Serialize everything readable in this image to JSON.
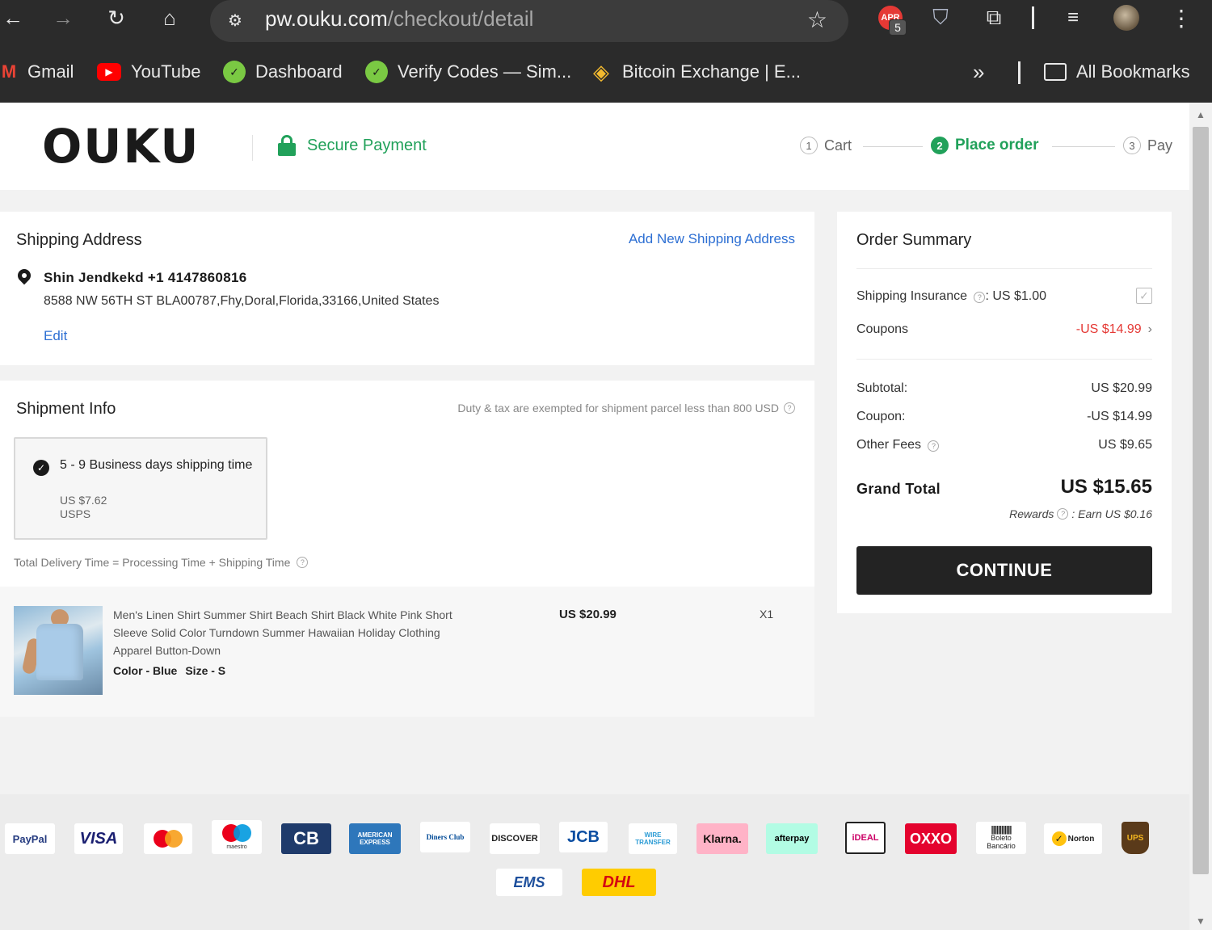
{
  "browser": {
    "url_host": "pw.ouku.com",
    "url_path": "/checkout/detail",
    "extensions": {
      "apr_label": "APR",
      "apr_badge": "5"
    },
    "bookmarks": [
      {
        "label": "Gmail",
        "icon": "gmail-icon"
      },
      {
        "label": "YouTube",
        "icon": "youtube-icon"
      },
      {
        "label": "Dashboard",
        "icon": "dashboard-icon"
      },
      {
        "label": "Verify Codes — Sim...",
        "icon": "verify-codes-icon"
      },
      {
        "label": "Bitcoin Exchange | E...",
        "icon": "binance-icon"
      }
    ],
    "more_label": "»",
    "all_bookmarks": "All Bookmarks"
  },
  "header": {
    "logo": "OUKU",
    "secure_label": "Secure Payment",
    "steps": [
      {
        "num": "1",
        "label": "Cart",
        "active": false
      },
      {
        "num": "2",
        "label": "Place order",
        "active": true
      },
      {
        "num": "3",
        "label": "Pay",
        "active": false
      }
    ]
  },
  "address": {
    "title": "Shipping Address",
    "add_new": "Add New Shipping Address",
    "name_phone": "Shin Jendkekd +1 4147860816",
    "line": "8588 NW 56TH ST BLA00787,Fhy,Doral,Florida,33166,United States",
    "edit": "Edit"
  },
  "shipment": {
    "title": "Shipment Info",
    "duty_note": "Duty & tax are exempted for shipment parcel less than 800 USD",
    "option": {
      "title": "5 - 9 Business days shipping time",
      "price": "US $7.62",
      "carrier": "USPS",
      "selected": true
    },
    "delivery_note": "Total Delivery Time = Processing Time + Shipping Time"
  },
  "item": {
    "title": "Men's Linen Shirt Summer Shirt Beach Shirt Black White Pink Short Sleeve Solid Color Turndown Summer Hawaiian Holiday Clothing Apparel Button-Down",
    "color": "Color - Blue",
    "size": "Size - S",
    "price": "US $20.99",
    "qty": "X1"
  },
  "summary": {
    "title": "Order Summary",
    "insurance_label": "Shipping Insurance",
    "insurance_value": ": US $1.00",
    "insurance_checked": true,
    "coupons_label": "Coupons",
    "coupons_value": "-US $14.99",
    "subtotal_label": "Subtotal:",
    "subtotal_value": "US $20.99",
    "coupon_label": "Coupon:",
    "coupon_value": "-US $14.99",
    "other_fees_label": "Other Fees",
    "other_fees_value": "US $9.65",
    "grand_total_label": "Grand Total",
    "grand_total_value": "US $15.65",
    "rewards_label": "Rewards",
    "rewards_value": ": Earn US $0.16",
    "continue": "CONTINUE"
  },
  "payment_methods": [
    {
      "label": "PayPal",
      "bg": "#ffffff",
      "fg": "#253b80"
    },
    {
      "label": "VISA",
      "bg": "#ffffff",
      "fg": "#1a1f71"
    },
    {
      "label": "",
      "bg": "#ffffff",
      "fg": "#eb001b"
    },
    {
      "label": "maestro",
      "bg": "#ffffff",
      "fg": "#0099df"
    },
    {
      "label": "CB",
      "bg": "#1f3b6b",
      "fg": "#ffffff"
    },
    {
      "label": "AMERICAN EXPRESS",
      "bg": "#2e77bb",
      "fg": "#ffffff"
    },
    {
      "label": "Diners Club",
      "bg": "#ffffff",
      "fg": "#004a97"
    },
    {
      "label": "DISCOVER",
      "bg": "#ffffff",
      "fg": "#222222"
    },
    {
      "label": "JCB",
      "bg": "#ffffff",
      "fg": "#0b4ea2"
    },
    {
      "label": "WIRE TRANSFER",
      "bg": "#ffffff",
      "fg": "#2a9bd5"
    },
    {
      "label": "Klarna.",
      "bg": "#ffb3c7",
      "fg": "#17120f"
    },
    {
      "label": "afterpay",
      "bg": "#b2fce4",
      "fg": "#000000"
    },
    {
      "label": "iDEAL",
      "bg": "#ffffff",
      "fg": "#cc0066"
    },
    {
      "label": "OXXO",
      "bg": "#e4032e",
      "fg": "#ffffff"
    },
    {
      "label": "Boleto Bancário",
      "bg": "#ffffff",
      "fg": "#222222"
    },
    {
      "label": "Norton",
      "bg": "#ffffff",
      "fg": "#222222"
    },
    {
      "label": "UPS",
      "bg": "#5a3a1a",
      "fg": "#f2b51f"
    },
    {
      "label": "EMS",
      "bg": "#ffffff",
      "fg": "#1d4f9c"
    },
    {
      "label": "DHL",
      "bg": "#ffcc00",
      "fg": "#d40511"
    }
  ]
}
